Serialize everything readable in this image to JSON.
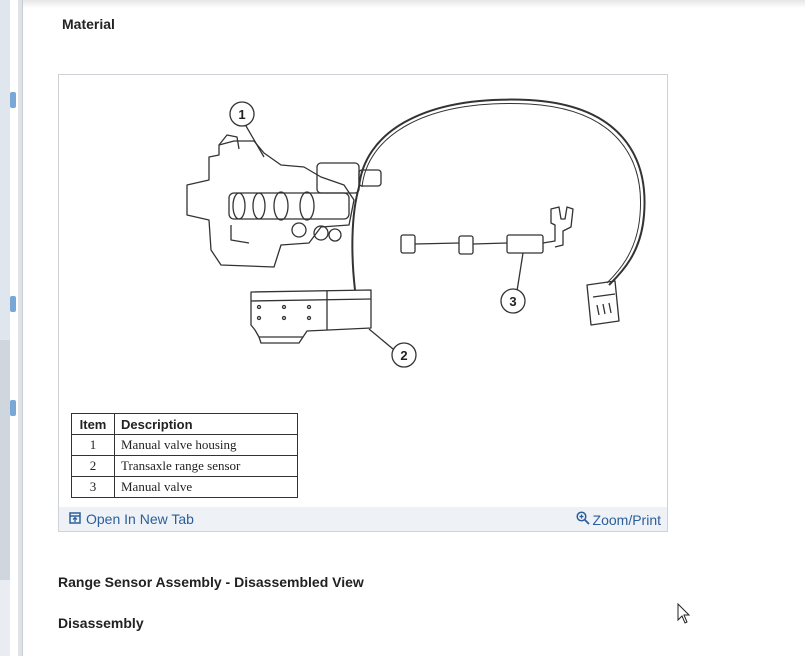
{
  "sections": {
    "material_heading": "Material",
    "figure_caption": "Range Sensor Assembly - Disassembled View",
    "disassembly_heading": "Disassembly"
  },
  "figure": {
    "callouts": [
      "1",
      "2",
      "3"
    ],
    "legend": {
      "headers": {
        "item": "Item",
        "description": "Description"
      },
      "rows": [
        {
          "item": "1",
          "description": "Manual valve housing"
        },
        {
          "item": "2",
          "description": "Transaxle range sensor"
        },
        {
          "item": "3",
          "description": "Manual valve"
        }
      ]
    },
    "footer": {
      "open_tab_label": "Open In New Tab",
      "zoom_label": "Zoom/Print",
      "open_tab_icon": "open-in-new-tab-icon",
      "zoom_icon": "magnifier-icon"
    }
  },
  "colors": {
    "link": "#2b5f9c",
    "footer_bg": "#eef1f5",
    "text": "#222222"
  }
}
